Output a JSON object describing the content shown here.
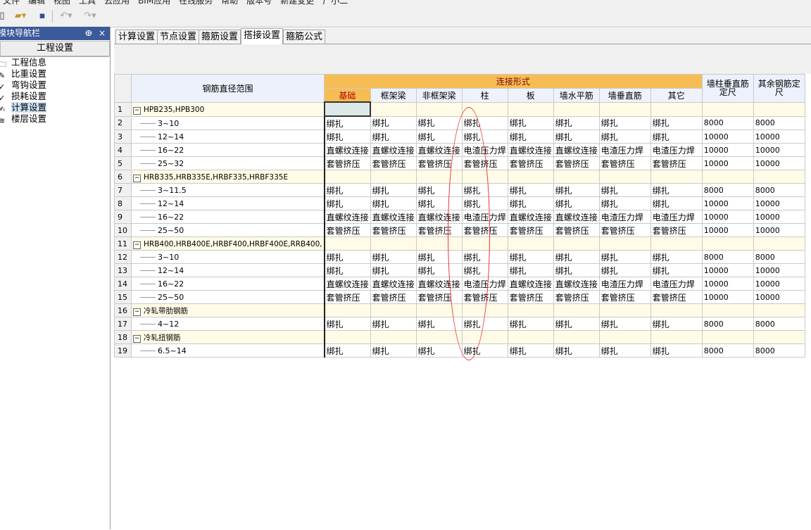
{
  "menubar": {
    "items": [
      "文件",
      "编辑",
      "视图",
      "工具",
      "云应用",
      "BIM应用",
      "在线服务",
      "帮助",
      "版本号",
      "新建变更",
      "广小二"
    ]
  },
  "toolbar": {
    "icons": [
      "new-file-icon",
      "open-folder-icon",
      "save-icon",
      "undo-icon",
      "redo-icon"
    ]
  },
  "nav": {
    "title": "模块导航栏",
    "pin": "ⴲ",
    "close": "×",
    "section": "工程设置",
    "items": [
      {
        "label": "工程信息",
        "icon": "info-icon"
      },
      {
        "label": "比重设置",
        "icon": "weight-icon"
      },
      {
        "label": "弯钩设置",
        "icon": "hook-icon"
      },
      {
        "label": "损耗设置",
        "icon": "loss-icon"
      },
      {
        "label": "计算设置",
        "icon": "calc-icon",
        "selected": true
      },
      {
        "label": "楼层设置",
        "icon": "floor-icon"
      }
    ]
  },
  "tabs": [
    {
      "label": "计算设置"
    },
    {
      "label": "节点设置"
    },
    {
      "label": "箍筋设置"
    },
    {
      "label": "搭接设置",
      "active": true
    },
    {
      "label": "箍筋公式"
    }
  ],
  "grid": {
    "header": {
      "range": "钢筋直径范围",
      "conn": "连接形式",
      "subs": [
        "基础",
        "框架梁",
        "非框架梁",
        "柱",
        "板",
        "墙水平筋",
        "墙垂直筋",
        "其它"
      ],
      "wall_len": "墙柱垂直筋定尺",
      "other_len": "其余钢筋定尺"
    },
    "rows": [
      {
        "n": "1",
        "group": true,
        "label": "HPB235,HPB300"
      },
      {
        "n": "2",
        "label": "3~10",
        "c": [
          "绑扎",
          "绑扎",
          "绑扎",
          "绑扎",
          "绑扎",
          "绑扎",
          "绑扎",
          "绑扎"
        ],
        "a": "8000",
        "b": "8000"
      },
      {
        "n": "3",
        "label": "12~14",
        "c": [
          "绑扎",
          "绑扎",
          "绑扎",
          "绑扎",
          "绑扎",
          "绑扎",
          "绑扎",
          "绑扎"
        ],
        "a": "10000",
        "b": "10000"
      },
      {
        "n": "4",
        "label": "16~22",
        "c": [
          "直螺纹连接",
          "直螺纹连接",
          "直螺纹连接",
          "电渣压力焊",
          "直螺纹连接",
          "直螺纹连接",
          "电渣压力焊",
          "电渣压力焊"
        ],
        "a": "10000",
        "b": "10000"
      },
      {
        "n": "5",
        "label": "25~32",
        "c": [
          "套管挤压",
          "套管挤压",
          "套管挤压",
          "套管挤压",
          "套管挤压",
          "套管挤压",
          "套管挤压",
          "套管挤压"
        ],
        "a": "10000",
        "b": "10000"
      },
      {
        "n": "6",
        "group": true,
        "label": "HRB335,HRB335E,HRBF335,HRBF335E"
      },
      {
        "n": "7",
        "label": "3~11.5",
        "c": [
          "绑扎",
          "绑扎",
          "绑扎",
          "绑扎",
          "绑扎",
          "绑扎",
          "绑扎",
          "绑扎"
        ],
        "a": "8000",
        "b": "8000"
      },
      {
        "n": "8",
        "label": "12~14",
        "c": [
          "绑扎",
          "绑扎",
          "绑扎",
          "绑扎",
          "绑扎",
          "绑扎",
          "绑扎",
          "绑扎"
        ],
        "a": "10000",
        "b": "10000"
      },
      {
        "n": "9",
        "label": "16~22",
        "c": [
          "直螺纹连接",
          "直螺纹连接",
          "直螺纹连接",
          "电渣压力焊",
          "直螺纹连接",
          "直螺纹连接",
          "电渣压力焊",
          "电渣压力焊"
        ],
        "a": "10000",
        "b": "10000"
      },
      {
        "n": "10",
        "label": "25~50",
        "c": [
          "套管挤压",
          "套管挤压",
          "套管挤压",
          "套管挤压",
          "套管挤压",
          "套管挤压",
          "套管挤压",
          "套管挤压"
        ],
        "a": "10000",
        "b": "10000"
      },
      {
        "n": "11",
        "group": true,
        "label": "HRB400,HRB400E,HRBF400,HRBF400E,RRB400,"
      },
      {
        "n": "12",
        "label": "3~10",
        "c": [
          "绑扎",
          "绑扎",
          "绑扎",
          "绑扎",
          "绑扎",
          "绑扎",
          "绑扎",
          "绑扎"
        ],
        "a": "8000",
        "b": "8000"
      },
      {
        "n": "13",
        "label": "12~14",
        "c": [
          "绑扎",
          "绑扎",
          "绑扎",
          "绑扎",
          "绑扎",
          "绑扎",
          "绑扎",
          "绑扎"
        ],
        "a": "10000",
        "b": "10000"
      },
      {
        "n": "14",
        "label": "16~22",
        "c": [
          "直螺纹连接",
          "直螺纹连接",
          "直螺纹连接",
          "电渣压力焊",
          "直螺纹连接",
          "直螺纹连接",
          "电渣压力焊",
          "电渣压力焊"
        ],
        "a": "10000",
        "b": "10000"
      },
      {
        "n": "15",
        "label": "25~50",
        "c": [
          "套管挤压",
          "套管挤压",
          "套管挤压",
          "套管挤压",
          "套管挤压",
          "套管挤压",
          "套管挤压",
          "套管挤压"
        ],
        "a": "10000",
        "b": "10000"
      },
      {
        "n": "16",
        "group": true,
        "label": "冷轧带肋钢筋"
      },
      {
        "n": "17",
        "label": "4~12",
        "c": [
          "绑扎",
          "绑扎",
          "绑扎",
          "绑扎",
          "绑扎",
          "绑扎",
          "绑扎",
          "绑扎"
        ],
        "a": "8000",
        "b": "8000"
      },
      {
        "n": "18",
        "group": true,
        "label": "冷轧扭钢筋"
      },
      {
        "n": "19",
        "label": "6.5~14",
        "c": [
          "绑扎",
          "绑扎",
          "绑扎",
          "绑扎",
          "绑扎",
          "绑扎",
          "绑扎",
          "绑扎"
        ],
        "a": "8000",
        "b": "8000"
      }
    ]
  },
  "colors": {
    "header_conn": "#f7bd55",
    "group_row": "#fffbe6",
    "nav_header": "#3c5a9a",
    "annotation": "#e33333"
  }
}
